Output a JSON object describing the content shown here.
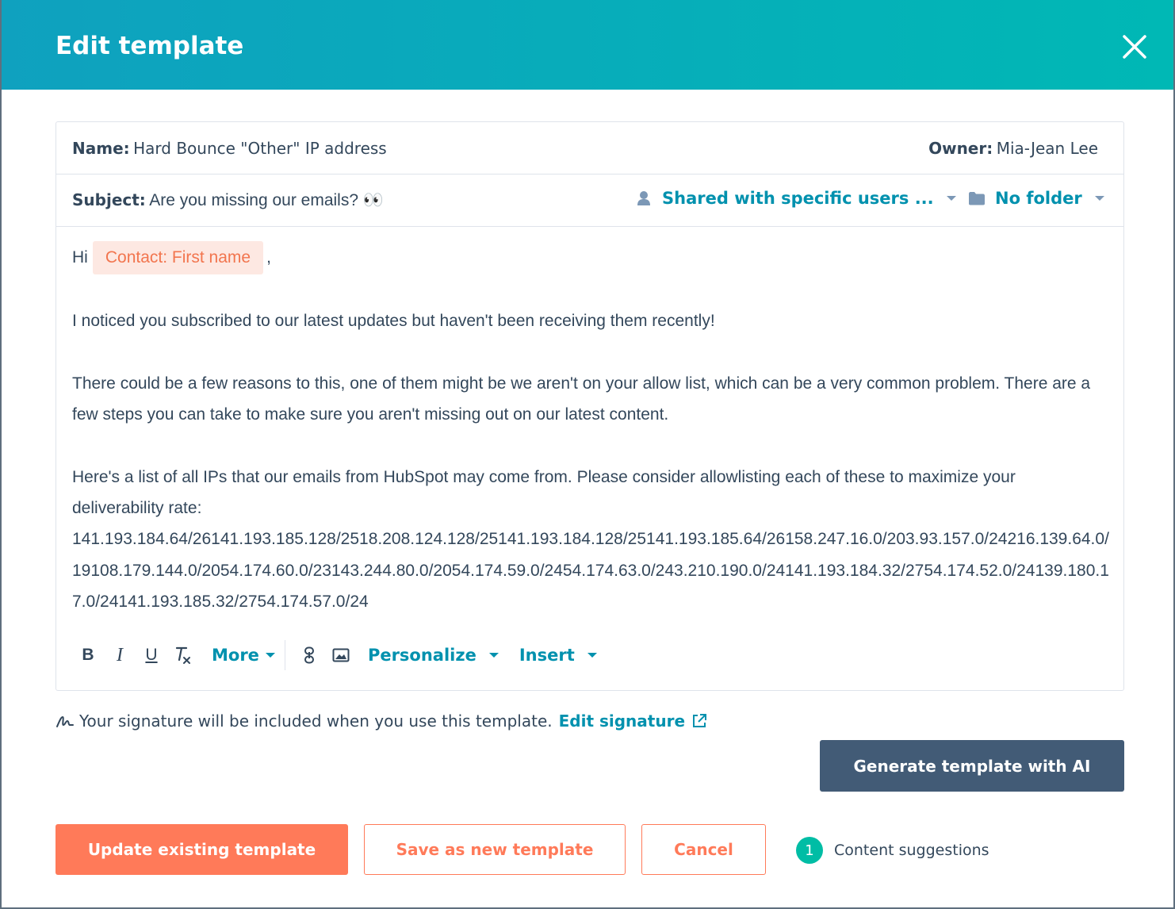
{
  "header": {
    "title": "Edit template",
    "close_icon": "close-icon"
  },
  "template": {
    "name_label": "Name:",
    "name_value": "Hard Bounce \"Other\" IP address",
    "owner_label": "Owner:",
    "owner_value": "Mia-Jean Lee",
    "subject_label": "Subject:",
    "subject_value": "Are you missing our emails? 👀",
    "sharing_label": "Shared with specific users ...",
    "folder_label": "No folder"
  },
  "body": {
    "greeting": "Hi",
    "token": "Contact: First name",
    "greeting_suffix": ",",
    "p1": "I noticed you subscribed to our latest updates but haven't been receiving them recently!",
    "p2": "There could be a few reasons to this, one of them might be we aren't on your allow list, which can be a very common problem. There are a few steps you can take to make sure you aren't missing out on our latest content.",
    "p3": "Here's a list of all IPs that our emails from HubSpot may come from. Please consider allowlisting each of these to maximize your deliverability rate:",
    "ips": "141.193.184.64/26141.193.185.128/2518.208.124.128/25141.193.184.128/25141.193.185.64/26158.247.16.0/203.93.157.0/24216.139.64.0/19108.179.144.0/2054.174.60.0/23143.244.80.0/2054.174.59.0/2454.174.63.0/243.210.190.0/24141.193.184.32/2754.174.52.0/24139.180.17.0/24141.193.185.32/2754.174.57.0/24"
  },
  "toolbar": {
    "bold": "B",
    "italic": "I",
    "underline": "U",
    "more": "More",
    "personalize": "Personalize",
    "insert": "Insert"
  },
  "signature": {
    "text": "Your signature will be included when you use this template.",
    "link": "Edit signature"
  },
  "actions": {
    "ai": "Generate template with AI",
    "update": "Update existing template",
    "save_new": "Save as new template",
    "cancel": "Cancel",
    "suggestions_count": "1",
    "suggestions_label": "Content suggestions"
  },
  "colors": {
    "header_start": "#0fa1bf",
    "header_end": "#00b8b5",
    "accent_orange": "#ff7a59",
    "link_blue": "#0091ae",
    "ai_button": "#425b76",
    "badge_green": "#00bda5"
  }
}
